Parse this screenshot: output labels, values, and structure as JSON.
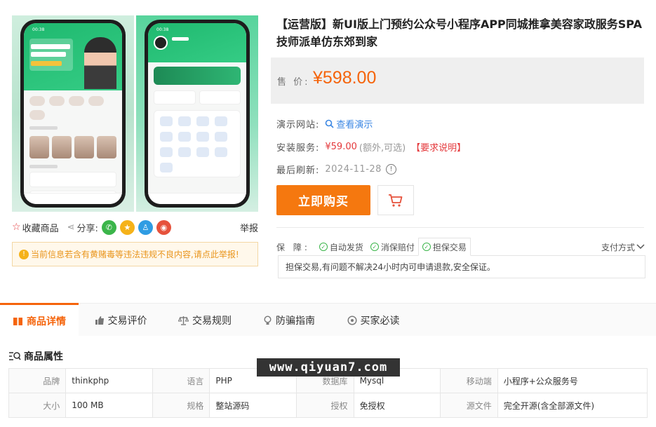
{
  "product": {
    "title": "【运营版】新UI版上门预约公众号小程序APP同城推拿美容家政服务SPA技师派单仿东郊到家",
    "price_label": "售 价:",
    "price": "¥598.00"
  },
  "info": {
    "demo_label": "演示网站:",
    "demo_link": "查看演示",
    "install_label": "安装服务:",
    "install_price": "¥59.00",
    "install_note": "(额外,可选)",
    "install_req": "【要求说明】",
    "refresh_label": "最后刷新:",
    "refresh_date": "2024-11-28"
  },
  "actions": {
    "buy": "立即购买"
  },
  "share": {
    "favorite": "收藏商品",
    "share_label": "分享:",
    "report": "举报",
    "notice": "当前信息若含有黄赌毒等违法违规不良内容,请点此举报!"
  },
  "guarantee": {
    "label": "保 障:",
    "items": [
      "自动发货",
      "消保赔付",
      "担保交易"
    ],
    "payment": "支付方式",
    "desc": "担保交易,有问题不解决24小时内可申请退款,安全保证。"
  },
  "tabs": [
    {
      "label": "商品详情",
      "icon": "gift-icon"
    },
    {
      "label": "交易评价",
      "icon": "thumbs-up-icon"
    },
    {
      "label": "交易规则",
      "icon": "scale-icon"
    },
    {
      "label": "防骗指南",
      "icon": "bulb-icon"
    },
    {
      "label": "买家必读",
      "icon": "target-icon"
    }
  ],
  "attributes": {
    "heading": "商品属性",
    "rows": [
      [
        {
          "k": "品牌",
          "v": "thinkphp"
        },
        {
          "k": "语言",
          "v": "PHP"
        },
        {
          "k": "数据库",
          "v": "Mysql"
        },
        {
          "k": "移动端",
          "v": "小程序+公众服务号"
        }
      ],
      [
        {
          "k": "大小",
          "v": "100 MB"
        },
        {
          "k": "规格",
          "v": "整站源码"
        },
        {
          "k": "授权",
          "v": "免授权"
        },
        {
          "k": "源文件",
          "v": "完全开源(含全部源文件)"
        }
      ]
    ]
  },
  "watermark": "www.qiyuan7.com",
  "colors": {
    "accent": "#f5640b",
    "buy_button": "#f5780f",
    "link": "#3b87e3",
    "alert_red": "#e4393c",
    "success_green": "#3bb54a"
  }
}
